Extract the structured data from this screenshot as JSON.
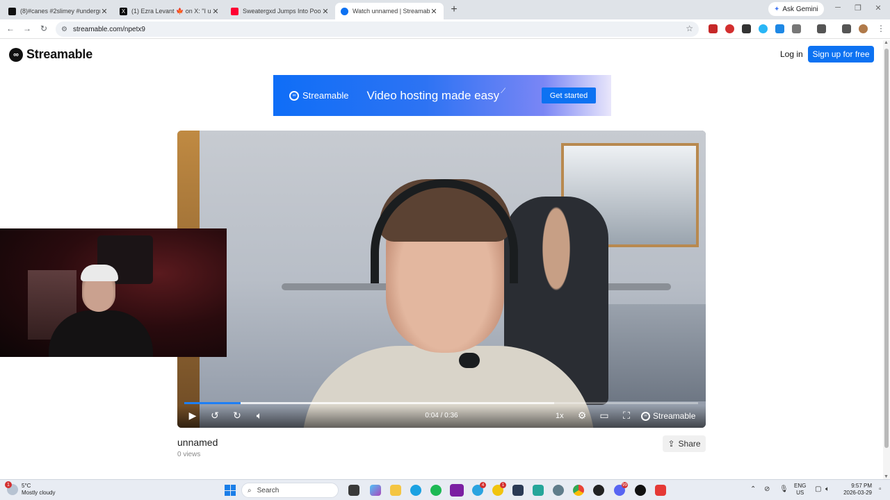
{
  "browser": {
    "tabs": [
      {
        "title": "(8)#canes #2slimey #undergrou",
        "color": "#111111"
      },
      {
        "title": "(1) Ezra Levant 🍁 on X: \"I u",
        "color": "#000000"
      },
      {
        "title": "Sweatergxd Jumps Into Pool - Y",
        "color": "#ff0033"
      },
      {
        "title": "Watch unnamed | Streamable",
        "color": "#0d72f2"
      }
    ],
    "new_tab": "+",
    "ask_gemini": "Ask Gemini",
    "url": "streamable.com/npetx9"
  },
  "site": {
    "logo": "Streamable",
    "login": "Log in",
    "signup": "Sign up for free"
  },
  "banner": {
    "brand": "Streamable",
    "tagline": "Video hosting made easy",
    "cta": "Get started"
  },
  "video": {
    "time": "0:04 / 0:36",
    "speed": "1x",
    "brand": "Streamable",
    "played_fraction": 0.11,
    "buffered_fraction": 0.72
  },
  "meta": {
    "title": "unnamed",
    "views": "0 views",
    "share": "Share"
  },
  "taskbar": {
    "weather_temp": "5°C",
    "weather_desc": "Mostly cloudy",
    "weather_badge": "1",
    "search": "Search",
    "lang_1": "ENG",
    "lang_2": "US",
    "time": "9:57 PM",
    "date": "2026-03-29",
    "badges": {
      "telegram": "4",
      "app": "1",
      "discord": "99"
    }
  }
}
